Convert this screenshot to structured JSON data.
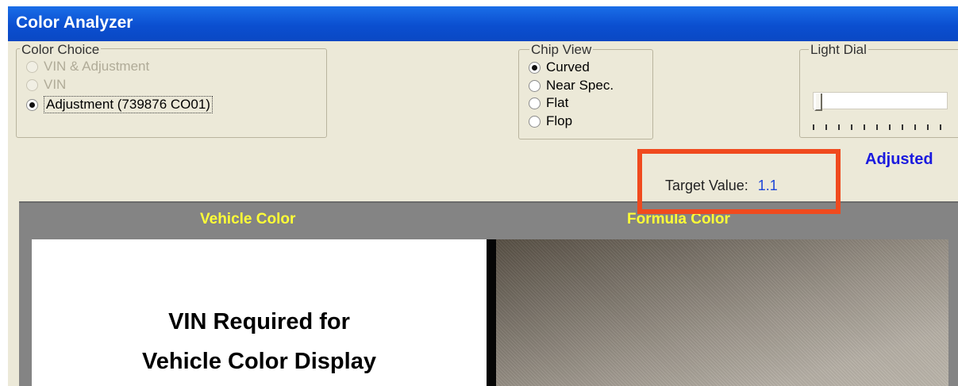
{
  "window": {
    "title": "Color Analyzer"
  },
  "color_choice": {
    "legend": "Color Choice",
    "options": [
      {
        "label": "VIN & Adjustment",
        "selected": false,
        "disabled": true
      },
      {
        "label": "VIN",
        "selected": false,
        "disabled": true
      },
      {
        "label": "Adjustment (739876 CO01)",
        "selected": true,
        "disabled": false
      }
    ]
  },
  "chip_view": {
    "legend": "Chip View",
    "options": [
      {
        "label": "Curved",
        "selected": true
      },
      {
        "label": "Near Spec.",
        "selected": false
      },
      {
        "label": "Flat",
        "selected": false
      },
      {
        "label": "Flop",
        "selected": false
      }
    ]
  },
  "light_dial": {
    "legend": "Light Dial",
    "value_fraction": 0.0
  },
  "status": {
    "adjusted_label": "Adjusted",
    "target_value_label": "Target Value:",
    "target_value": "1.1"
  },
  "display": {
    "vehicle_color_title": "Vehicle Color",
    "formula_color_title": "Formula Color",
    "vin_message_line1": "VIN Required for",
    "vin_message_line2": "Vehicle Color Display"
  },
  "colors": {
    "title_bar": "#0b4fd0",
    "window_bg": "#ece9d8",
    "adjusted_text": "#1a1adf",
    "target_value_text": "#1d45d8",
    "highlight_box": "#f04a1e",
    "panel_title": "#ffff37",
    "display_bg": "#848484"
  }
}
